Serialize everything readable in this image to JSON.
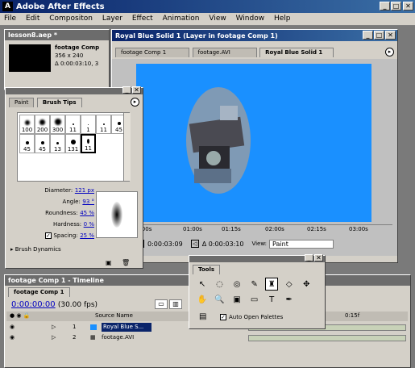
{
  "app": {
    "title": "Adobe After Effects"
  },
  "menu": [
    "File",
    "Edit",
    "Compositon",
    "Layer",
    "Effect",
    "Animation",
    "View",
    "Window",
    "Help"
  ],
  "project": {
    "title": "lesson8.aep *",
    "item_name": "footage Comp",
    "item_size": "356 x 240",
    "item_duration": "Δ 0:00:03:10, 3"
  },
  "layer_window": {
    "title": "Royal Blue Solid 1 (Layer in footage Comp 1)",
    "tabs": [
      "footage Comp 1",
      "footage.AVI",
      "Royal Blue Solid 1"
    ],
    "ruler": [
      "0:00s",
      "01:00s",
      "01:15s",
      "02:00s",
      "02:15s",
      "03:00s"
    ],
    "time_in": "0:00:03:09",
    "time_dur": "Δ 0:00:03:10",
    "view_label": "View:",
    "view_value": "Paint",
    "canvas_color": "#1a90ff"
  },
  "brush_panel": {
    "tabs": [
      "Paint",
      "Brush Tips"
    ],
    "sizes": [
      "100",
      "200",
      "300",
      "11",
      "1",
      "11",
      "45",
      "45",
      "45",
      "13",
      "131",
      "11"
    ],
    "diameter_label": "Diameter:",
    "diameter": "121 px",
    "angle_label": "Angle:",
    "angle": "93 °",
    "roundness_label": "Roundness:",
    "roundness": "45 %",
    "hardness_label": "Hardness:",
    "hardness": "0 %",
    "spacing_label": "Spacing:",
    "spacing": "25 %",
    "dynamics": "Brush Dynamics"
  },
  "tools": {
    "title": "Tools",
    "auto_open": "Auto Open Palettes"
  },
  "timeline": {
    "title": "footage Comp 1 - Timeline",
    "tab": "footage Comp 1",
    "time": "0:00:00:00",
    "fps": "(30.00 fps)",
    "col_source": "Source Name",
    "ruler_mark": "0:15f",
    "layers": [
      {
        "num": "1",
        "name": "Royal Blue S..."
      },
      {
        "num": "2",
        "name": "footage.AVI"
      }
    ]
  }
}
